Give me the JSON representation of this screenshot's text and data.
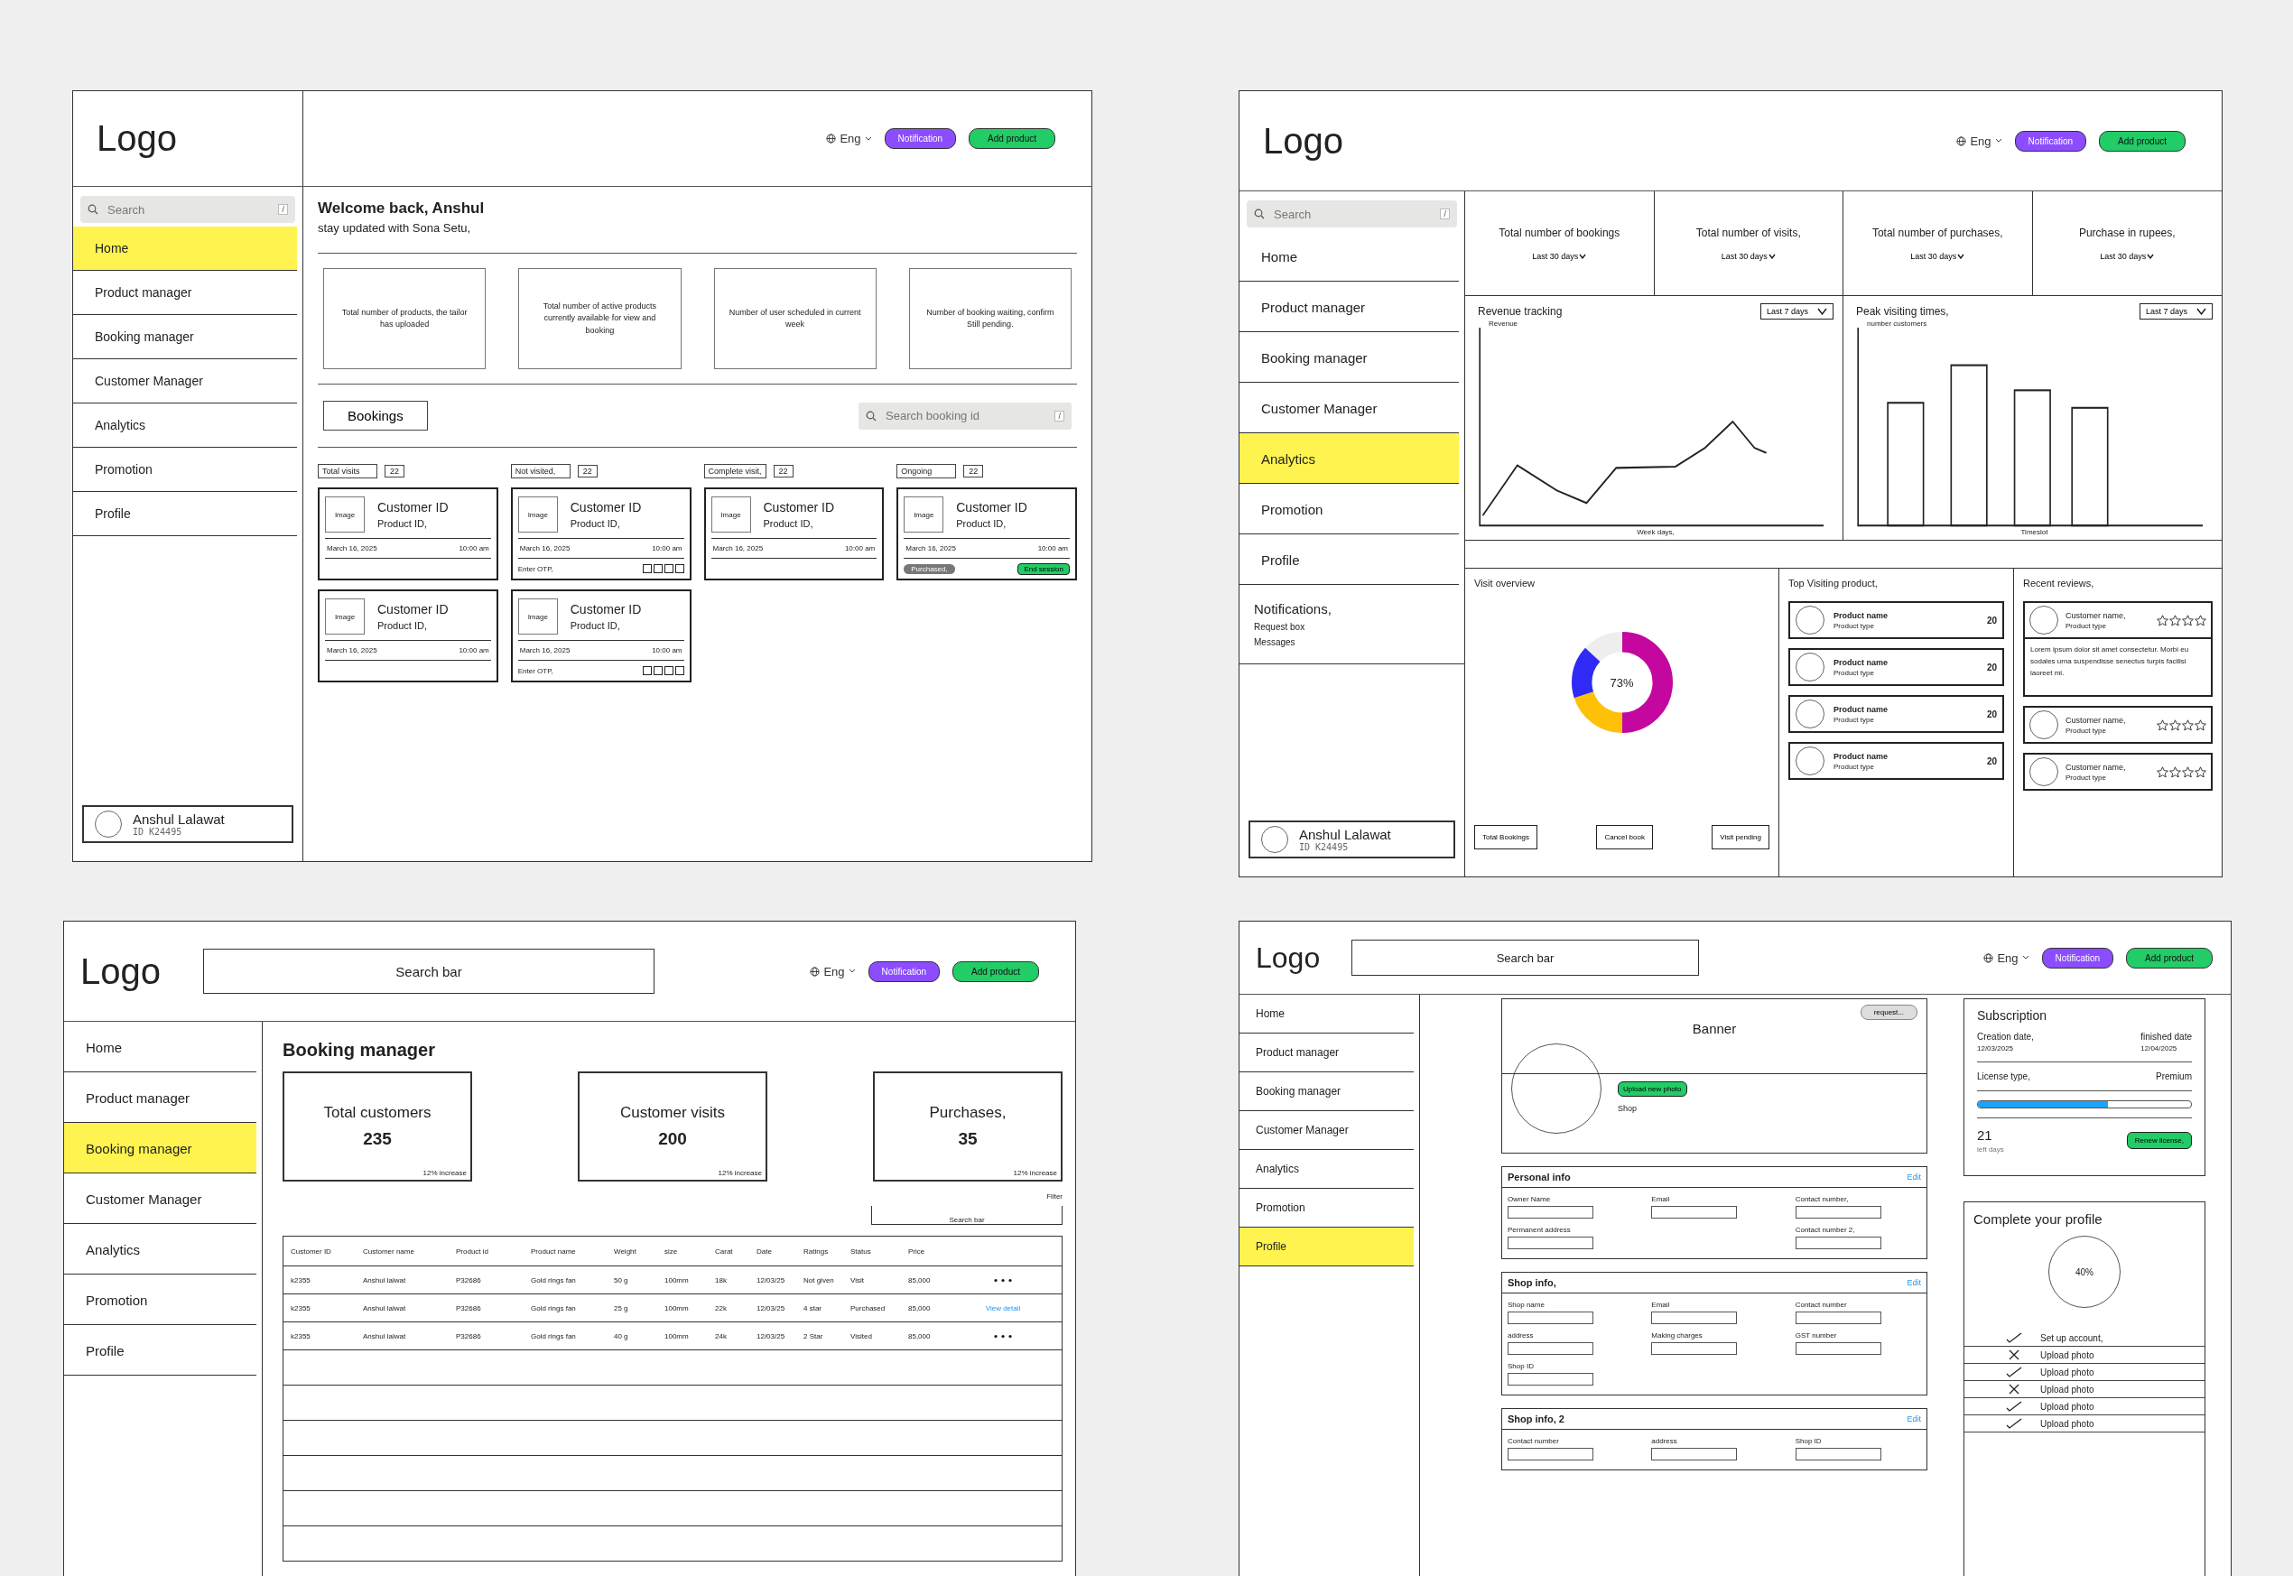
{
  "screens": [
    {
      "kind": "home",
      "header": {
        "logo": "Logo",
        "language": "Eng",
        "buttons": [
          {
            "label": "Notification",
            "kind": "notify"
          },
          {
            "label": "Add product",
            "kind": "add"
          }
        ]
      },
      "sidebar": {
        "search": {
          "placeholder": "Search",
          "shortcut": "/"
        },
        "items": [
          {
            "label": "Home",
            "selected": true
          },
          {
            "label": "Product manager",
            "selected": false
          },
          {
            "label": "Booking manager",
            "selected": false
          },
          {
            "label": "Customer Manager",
            "selected": false
          },
          {
            "label": "Analytics",
            "selected": false
          },
          {
            "label": "Promotion",
            "selected": false
          },
          {
            "label": "Profile",
            "selected": false
          }
        ],
        "user": {
          "name": "Anshul Lalawat",
          "id": "ID K24495"
        }
      },
      "main": {
        "title": "Welcome back, Anshul",
        "subtitle": "stay updated with Sona Setu,",
        "stat_cards": [
          "Total number of products, the tailor has uploaded",
          "Total number of active products currently available for view and booking",
          "Number of user scheduled in current week",
          "Number of booking waiting, confirm Still pending."
        ],
        "bookings_button": "Bookings",
        "search": {
          "placeholder": "Search booking id",
          "shortcut": "/"
        },
        "columns": [
          {
            "filter": "Total visits",
            "count": "22",
            "cards": [
              {
                "kind": "plain",
                "image": "Image",
                "customer": "Customer ID",
                "product": "Product ID,",
                "date": "March 16, 2025",
                "time": "10:00 am"
              },
              {
                "kind": "plain",
                "image": "Image",
                "customer": "Customer ID",
                "product": "Product ID,",
                "date": "March 16, 2025",
                "time": "10:00 am"
              }
            ]
          },
          {
            "filter": "Not visited,",
            "count": "22",
            "cards": [
              {
                "kind": "otp",
                "image": "Image",
                "customer": "Customer ID",
                "product": "Product ID,",
                "date": "March 16, 2025",
                "time": "10:00 am",
                "otp": "Enter OTP,"
              },
              {
                "kind": "otp",
                "image": "Image",
                "customer": "Customer ID",
                "product": "Product ID,",
                "date": "March 16, 2025",
                "time": "10:00 am",
                "otp": "Enter OTP,"
              }
            ]
          },
          {
            "filter": "Complete visit,",
            "count": "22",
            "cards": [
              {
                "kind": "plain",
                "image": "Image",
                "customer": "Customer ID",
                "product": "Product ID,",
                "date": "March 16, 2025",
                "time": "10:00 am"
              }
            ]
          },
          {
            "filter": "Ongoing",
            "count": "22",
            "cards": [
              {
                "kind": "session",
                "image": "Image",
                "customer": "Customer ID",
                "product": "Product ID,",
                "date": "March 16, 2025",
                "time": "10:00 am",
                "status": "Purchased,",
                "action": "End session"
              }
            ]
          }
        ]
      }
    },
    {
      "kind": "analytics",
      "header": {
        "logo": "Logo",
        "language": "Eng",
        "buttons": [
          {
            "label": "Notification",
            "kind": "notify"
          },
          {
            "label": "Add product",
            "kind": "add"
          }
        ]
      },
      "sidebar": {
        "search": {
          "placeholder": "Search",
          "shortcut": "/"
        },
        "items": [
          {
            "label": "Home",
            "selected": false
          },
          {
            "label": "Product manager",
            "selected": false
          },
          {
            "label": "Booking manager",
            "selected": false
          },
          {
            "label": "Customer Manager",
            "selected": false
          },
          {
            "label": "Analytics",
            "selected": true
          },
          {
            "label": "Promotion",
            "selected": false
          },
          {
            "label": "Profile",
            "selected": false
          }
        ],
        "notifications": {
          "title": "Notifications,",
          "items": [
            "Request box",
            "Messages"
          ]
        },
        "user": {
          "name": "Anshul Lalawat",
          "id": "ID K24495"
        }
      },
      "main": {
        "stats": [
          {
            "label": "Total number of bookings",
            "period": "Last 30 days"
          },
          {
            "label": "Total number of visits,",
            "period": "Last 30 days"
          },
          {
            "label": "Total number of purchases,",
            "period": "Last 30 days"
          },
          {
            "label": "Purchase in rupees,",
            "period": "Last 30 days"
          }
        ],
        "charts": [
          {
            "kind": "line",
            "title": "Revenue tracking",
            "range": "Last 7 days",
            "ylabel": "Revenue",
            "xlabel": "Week days,"
          },
          {
            "kind": "bar",
            "title": "Peak visiting times,",
            "range": "Last 7 days",
            "ylabel": "number customers",
            "xlabel": "Timeslot"
          }
        ],
        "visit_overview": {
          "title": "Visit overview",
          "center": "73%",
          "buttons": [
            "Total Bookings",
            "Cancel book",
            "Visit pending"
          ]
        },
        "top_products": {
          "title": "Top Visiting product,",
          "items": [
            {
              "name": "Product name",
              "type": "Product type",
              "count": "20"
            },
            {
              "name": "Product name",
              "type": "Product type",
              "count": "20"
            },
            {
              "name": "Product name",
              "type": "Product type",
              "count": "20"
            },
            {
              "name": "Product name",
              "type": "Product type",
              "count": "20"
            }
          ]
        },
        "reviews": {
          "title": "Recent reviews,",
          "items": [
            {
              "name": "Customer name,",
              "type": "Product type",
              "stars": 0,
              "text": "Lorem ipsum dolor sit amet consectetur. Morbi eu sodales urna suspendisse senectus turpis facilisi laoreet mi."
            },
            {
              "name": "Customer name,",
              "type": "Product type",
              "stars": 0
            },
            {
              "name": "Customer name,",
              "type": "Product type",
              "stars": 0
            }
          ]
        }
      }
    },
    {
      "kind": "booking",
      "header": {
        "logo": "Logo",
        "search_bar": {
          "placeholder": "Search bar"
        },
        "language": "Eng",
        "buttons": [
          {
            "label": "Notification",
            "kind": "notify"
          },
          {
            "label": "Add product",
            "kind": "add"
          }
        ]
      },
      "sidebar": {
        "items": [
          {
            "label": "Home",
            "selected": false
          },
          {
            "label": "Product manager",
            "selected": false
          },
          {
            "label": "Booking manager",
            "selected": true
          },
          {
            "label": "Customer Manager",
            "selected": false
          },
          {
            "label": "Analytics",
            "selected": false
          },
          {
            "label": "Promotion",
            "selected": false
          },
          {
            "label": "Profile",
            "selected": false
          }
        ]
      },
      "main": {
        "title": "Booking manager",
        "stat_cards": [
          {
            "label": "Total customers",
            "value": "235",
            "note": "12% increase"
          },
          {
            "label": "Customer visits",
            "value": "200",
            "note": "12% increase"
          },
          {
            "label": "Purchases,",
            "value": "35",
            "note": "12% increase"
          }
        ],
        "filter": "Filter",
        "search": "Search bar",
        "table": {
          "columns": [
            "Customer ID",
            "Customer name",
            "Product id",
            "Product name",
            "Weight",
            "size",
            "Carat",
            "Date",
            "Ratings",
            "Status",
            "Price"
          ],
          "rows": [
            {
              "cells": [
                "k2355",
                "Anshul lalwat",
                "P32686",
                "Gold rings fan",
                "50 g",
                "100mm",
                "18k",
                "12/03/25",
                "Not given",
                "Visit",
                "85,000"
              ],
              "action": {
                "kind": "menu"
              }
            },
            {
              "cells": [
                "k2355",
                "Anshul lalwat",
                "P32686",
                "Gold rings fan",
                "25 g",
                "100mm",
                "22k",
                "12/03/25",
                "4 star",
                "Purchased",
                "85,000"
              ],
              "action": {
                "kind": "link",
                "label": "View detail"
              }
            },
            {
              "cells": [
                "k2355",
                "Anshul lalwat",
                "P32686",
                "Gold rings fan",
                "40 g",
                "100mm",
                "24k",
                "12/03/25",
                "2 Star",
                "Visited",
                "85,000"
              ],
              "action": {
                "kind": "menu"
              }
            }
          ]
        }
      }
    },
    {
      "kind": "profile",
      "header": {
        "logo": "Logo",
        "search_bar": {
          "placeholder": "Search bar"
        },
        "language": "Eng",
        "buttons": [
          {
            "label": "Notification",
            "kind": "notify"
          },
          {
            "label": "Add product",
            "kind": "add"
          }
        ]
      },
      "sidebar": {
        "items": [
          {
            "label": "Home",
            "selected": false
          },
          {
            "label": "Product manager",
            "selected": false
          },
          {
            "label": "Booking manager",
            "selected": false
          },
          {
            "label": "Customer Manager",
            "selected": false
          },
          {
            "label": "Analytics",
            "selected": false
          },
          {
            "label": "Promotion",
            "selected": false
          },
          {
            "label": "Profile",
            "selected": true
          }
        ]
      },
      "main": {
        "banner": {
          "request": "request...",
          "title": "Banner",
          "upload": "Upload new photo",
          "shop": "Shop"
        },
        "sections": [
          {
            "title": "Personal info",
            "edit": "Edit",
            "rows": [
              [
                "Owner Name",
                "Email",
                "Contact number,"
              ],
              [
                "Permanent address",
                null,
                "Contact number 2,"
              ]
            ]
          },
          {
            "title": "Shop info,",
            "edit": "Edit",
            "rows": [
              [
                "Shop name",
                "Email",
                "Contact number"
              ],
              [
                "address",
                "Making charges",
                "GST number"
              ],
              [
                "Shop ID",
                null,
                null
              ]
            ]
          },
          {
            "title": "Shop info, 2",
            "edit": "Edit",
            "rows": [
              [
                "Contact number",
                "address",
                "Shop ID"
              ]
            ]
          }
        ],
        "subscription": {
          "title": "Subscription",
          "created_label": "Creation date,",
          "created": "12/03/2025",
          "finished_label": "finished date",
          "finished": "12/04/2025",
          "license_label": "License type,",
          "license": "Premium",
          "level": 0.61,
          "days": "21",
          "days_label": "left days",
          "renew": "Renew license,"
        },
        "completion": {
          "title": "Complete your profile",
          "percent": "40%",
          "items": [
            {
              "label": "Set up account,",
              "checked": true
            },
            {
              "label": "Upload photo",
              "checked": false
            },
            {
              "label": "Upload photo",
              "checked": true
            },
            {
              "label": "Upload photo",
              "checked": false
            },
            {
              "label": "Upload photo",
              "checked": true
            },
            {
              "label": "Upload photo",
              "checked": true
            }
          ]
        }
      }
    }
  ]
}
